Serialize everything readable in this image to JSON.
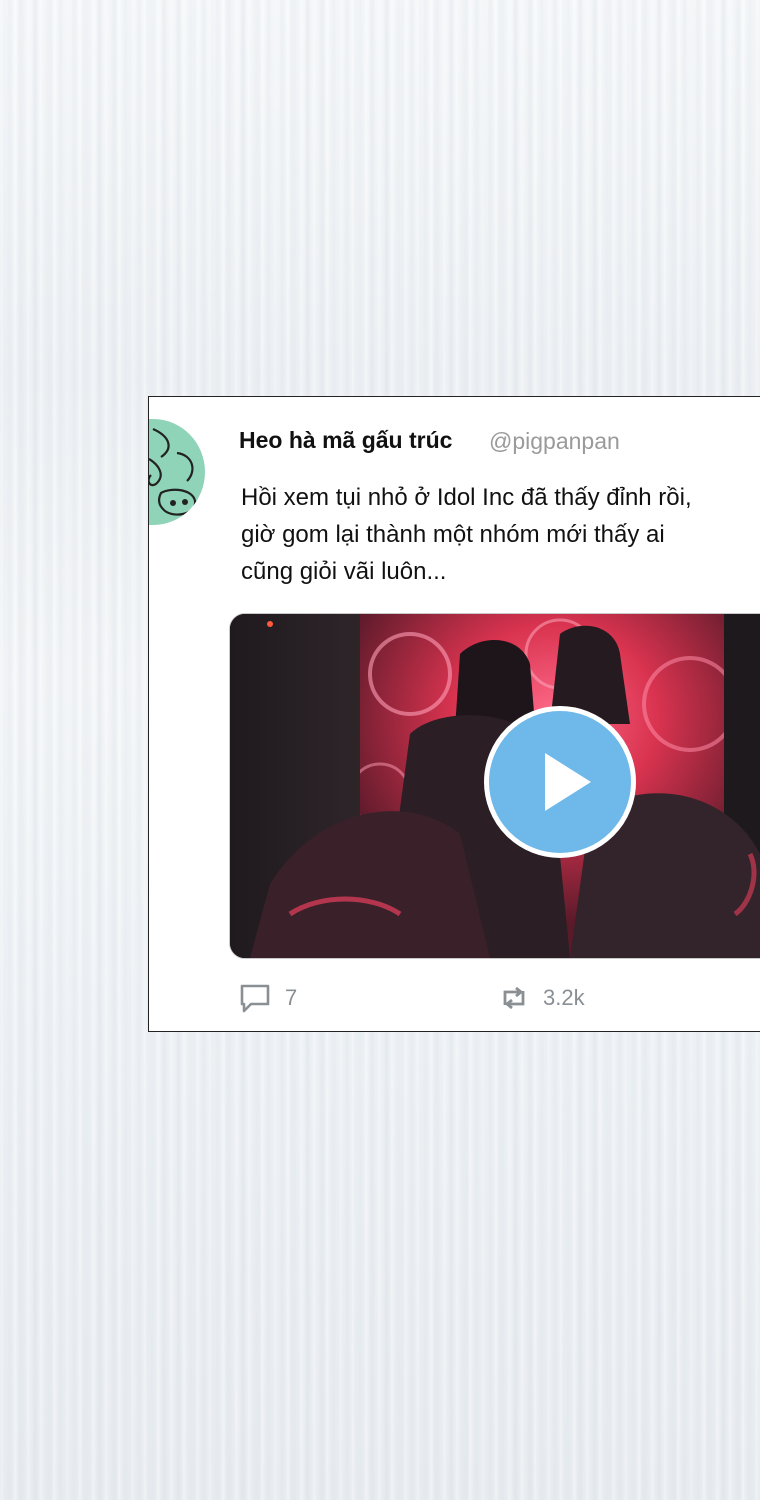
{
  "tweet": {
    "display_name": "Heo hà mã gấu trúc",
    "handle": "@pigpanpan",
    "text_lines": [
      "Hồi xem tụi nhỏ ở Idol Inc đã thấy đỉnh rồi,",
      "giờ gom lại thành một nhóm mới thấy ai",
      "cũng giỏi vãi luôn..."
    ],
    "media": {
      "type": "video",
      "icon": "play-icon"
    },
    "actions": {
      "reply_count": "7",
      "retweet_count": "3.2k"
    }
  },
  "colors": {
    "avatar_bg": "#8fd3b8",
    "play_button": "#6fb8ea",
    "muted_text": "#9a9a9a",
    "card_border": "#222222"
  }
}
